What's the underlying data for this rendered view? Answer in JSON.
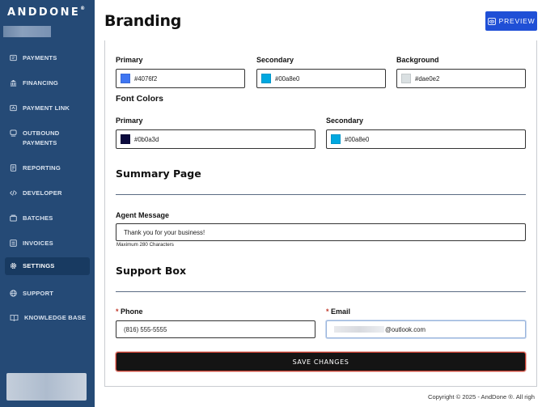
{
  "sidebar": {
    "logo": "ANDDONE",
    "logo_mark": "®",
    "items": [
      {
        "label": "PAYMENTS",
        "icon": "payments-icon"
      },
      {
        "label": "FINANCING",
        "icon": "bank-icon"
      },
      {
        "label": "PAYMENT LINK",
        "icon": "payment-link-icon"
      },
      {
        "label": "OUTBOUND PAYMENTS",
        "icon": "outbound-payments-icon"
      },
      {
        "label": "REPORTING",
        "icon": "reporting-icon"
      },
      {
        "label": "DEVELOPER",
        "icon": "code-icon"
      },
      {
        "label": "BATCHES",
        "icon": "batches-icon"
      },
      {
        "label": "INVOICES",
        "icon": "invoices-icon"
      },
      {
        "label": "SETTINGS",
        "icon": "gear-icon",
        "active": true
      },
      {
        "label": "SUPPORT",
        "icon": "globe-icon"
      },
      {
        "label": "KNOWLEDGE BASE",
        "icon": "book-icon"
      }
    ]
  },
  "header": {
    "title": "Branding",
    "preview_label": "PREVIEW"
  },
  "brand_colors": {
    "primary": {
      "label": "Primary",
      "value": "#4076f2",
      "swatch": "#4076f2"
    },
    "secondary": {
      "label": "Secondary",
      "value": "#00a8e0",
      "swatch": "#00a8e0"
    },
    "background": {
      "label": "Background",
      "value": "#dae0e2",
      "swatch": "#dae0e2"
    }
  },
  "font_colors": {
    "title": "Font Colors",
    "primary": {
      "label": "Primary",
      "value": "#0b0a3d",
      "swatch": "#0b0a3d"
    },
    "secondary": {
      "label": "Secondary",
      "value": "#00a8e0",
      "swatch": "#00a8e0"
    }
  },
  "summary_page": {
    "title": "Summary Page",
    "agent_message_label": "Agent Message",
    "agent_message_value": "Thank you for your business!",
    "agent_message_helper": "Maximum 280 Characters"
  },
  "support_box": {
    "title": "Support Box",
    "phone_label": "Phone",
    "phone_value": "(816) 555-5555",
    "email_label": "Email",
    "email_value": "@outlook.com",
    "required_mark": "*"
  },
  "save_label": "SAVE CHANGES",
  "footer": "Copyright © 2025 - AndDone ®. All righ"
}
